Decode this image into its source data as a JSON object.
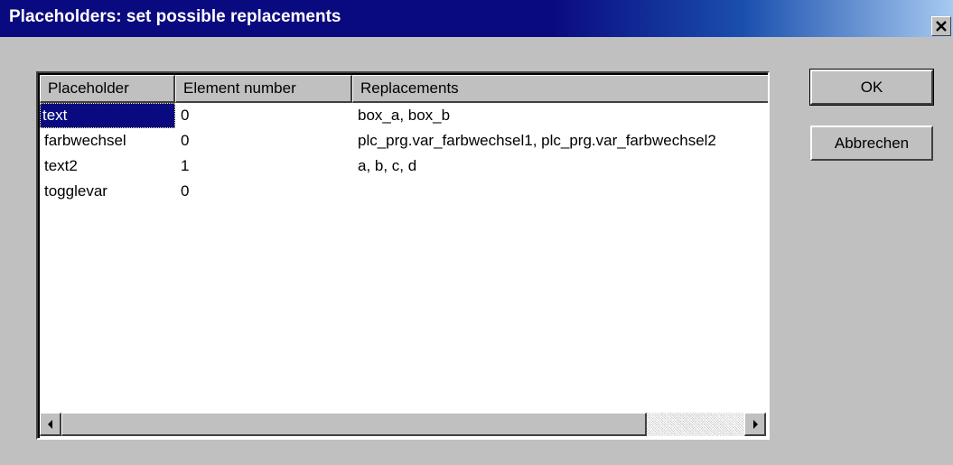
{
  "window": {
    "title": "Placeholders: set possible replacements"
  },
  "table": {
    "columns": [
      "Placeholder",
      "Element number",
      "Replacements"
    ],
    "rows": [
      {
        "placeholder": "text",
        "element_number": "0",
        "replacements": "box_a, box_b",
        "selected": true
      },
      {
        "placeholder": "farbwechsel",
        "element_number": "0",
        "replacements": "plc_prg.var_farbwechsel1, plc_prg.var_farbwechsel2",
        "selected": false
      },
      {
        "placeholder": "text2",
        "element_number": "1",
        "replacements": "a, b, c, d",
        "selected": false
      },
      {
        "placeholder": "togglevar",
        "element_number": "0",
        "replacements": "",
        "selected": false
      }
    ],
    "horizontal_scroll": 0.0
  },
  "buttons": {
    "ok_label": "OK",
    "cancel_label": "Abbrechen"
  },
  "icons": {
    "close": "close-icon",
    "scroll_left": "arrow-left-icon",
    "scroll_right": "arrow-right-icon"
  },
  "colors": {
    "titlebar": "#0a0a80",
    "selection": "#0a0a80",
    "face": "#c0c0c0"
  }
}
